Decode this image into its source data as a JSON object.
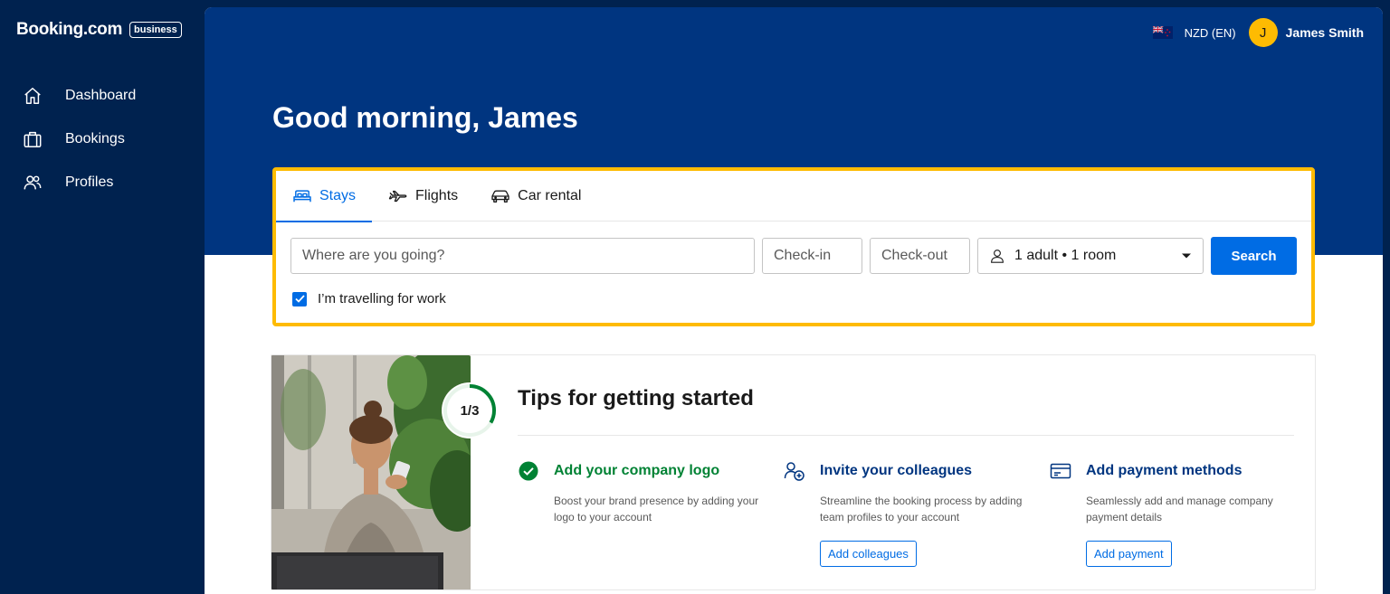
{
  "brand": {
    "name": "Booking.com",
    "badge": "business"
  },
  "sidebar": {
    "items": [
      {
        "label": "Dashboard",
        "icon": "home-icon"
      },
      {
        "label": "Bookings",
        "icon": "suitcase-icon"
      },
      {
        "label": "Profiles",
        "icon": "people-icon"
      }
    ]
  },
  "header": {
    "currency": "NZD (EN)",
    "flag": "new-zealand-flag-icon",
    "avatar_initial": "J",
    "user_name": "James Smith"
  },
  "greeting": "Good morning, James",
  "search": {
    "tabs": [
      {
        "label": "Stays",
        "icon": "bed-icon",
        "active": true
      },
      {
        "label": "Flights",
        "icon": "plane-icon",
        "active": false
      },
      {
        "label": "Car rental",
        "icon": "car-icon",
        "active": false
      }
    ],
    "destination_placeholder": "Where are you going?",
    "checkin_placeholder": "Check-in",
    "checkout_placeholder": "Check-out",
    "guests_value": "1 adult • 1 room",
    "search_label": "Search",
    "work_travel_label": "I’m travelling for work",
    "work_travel_checked": true
  },
  "tips": {
    "progress_label": "1/3",
    "progress_fraction": 0.333,
    "title": "Tips for getting started",
    "items": [
      {
        "title": "Add your company logo",
        "desc": "Boost your brand presence by adding your logo to your account",
        "icon": "check-circle-icon",
        "done": true
      },
      {
        "title": "Invite your colleagues",
        "desc": "Streamline the booking process by adding team profiles to your account",
        "icon": "add-person-icon",
        "button": "Add colleagues",
        "done": false
      },
      {
        "title": "Add payment methods",
        "desc": "Seamlessly add and manage company payment details",
        "icon": "credit-card-icon",
        "button": "Add payment",
        "done": false
      }
    ]
  },
  "colors": {
    "sidebar_bg": "#00224f",
    "hero_bg": "#003580",
    "accent_blue": "#006ce4",
    "highlight_yellow": "#febb02",
    "success_green": "#008234"
  }
}
